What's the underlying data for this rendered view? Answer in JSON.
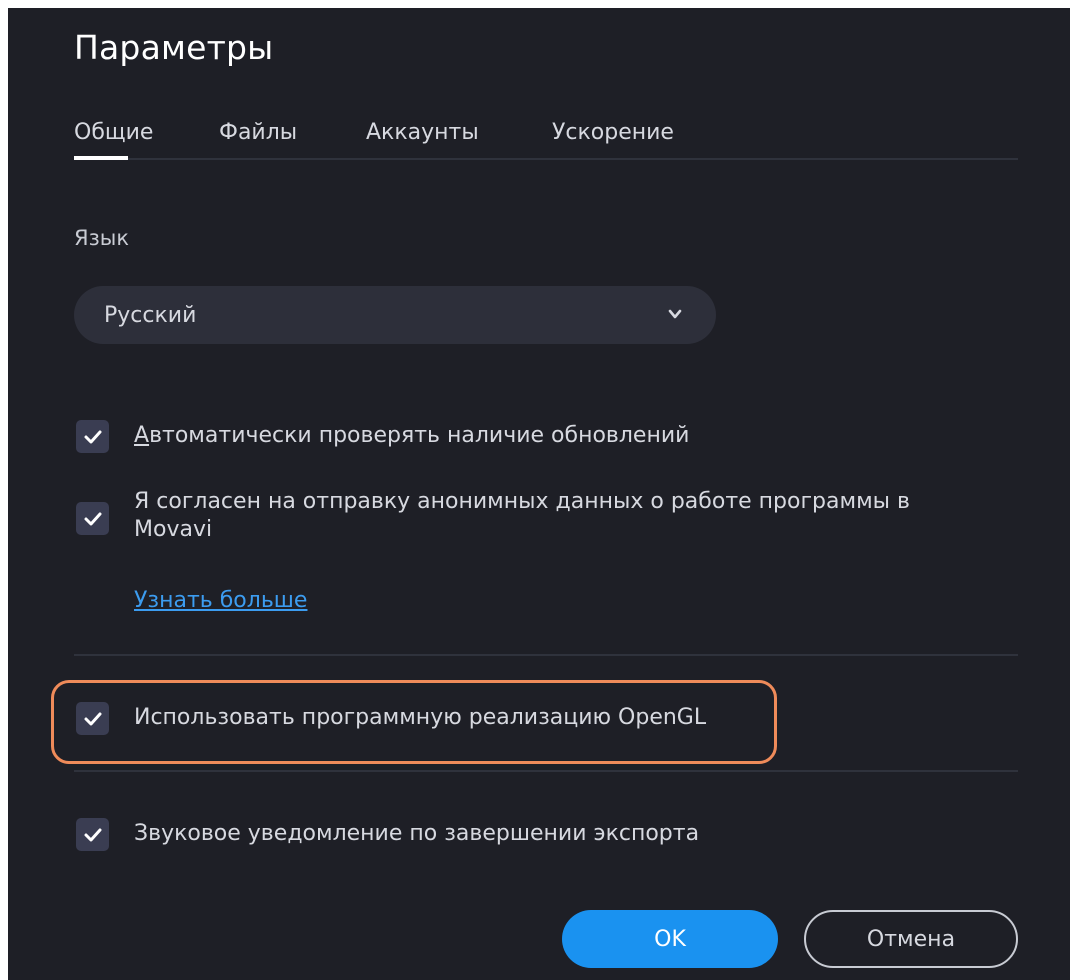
{
  "dialog": {
    "title": "Параметры",
    "tabs": [
      {
        "label": "Общие",
        "active": true
      },
      {
        "label": "Файлы",
        "active": false
      },
      {
        "label": "Аккаунты",
        "active": false
      },
      {
        "label": "Ускорение",
        "active": false
      }
    ],
    "language": {
      "label": "Язык",
      "selected": "Русский",
      "icon": "chevron-down-icon"
    },
    "options": {
      "auto_update": {
        "accel_char": "А",
        "rest": "втоматически проверять наличие обновлений",
        "checked": true
      },
      "anonymous_data": {
        "line1": "Я согласен на отправку анонимных данных о работе программы в",
        "line2": "Movavi",
        "checked": true
      },
      "learn_more": "Узнать больше",
      "opengl": {
        "label": "Использовать программную реализацию OpenGL",
        "checked": true
      },
      "sound": {
        "label": "Звуковое уведомление по завершении экспорта",
        "checked": true
      }
    },
    "buttons": {
      "ok": "OK",
      "cancel": "Отмена"
    },
    "colors": {
      "background": "#1e1f26",
      "accent": "#1a92f0",
      "link": "#3c9cf0",
      "highlight": "#ef8b5a",
      "checkbox": "#3a3d52"
    }
  }
}
